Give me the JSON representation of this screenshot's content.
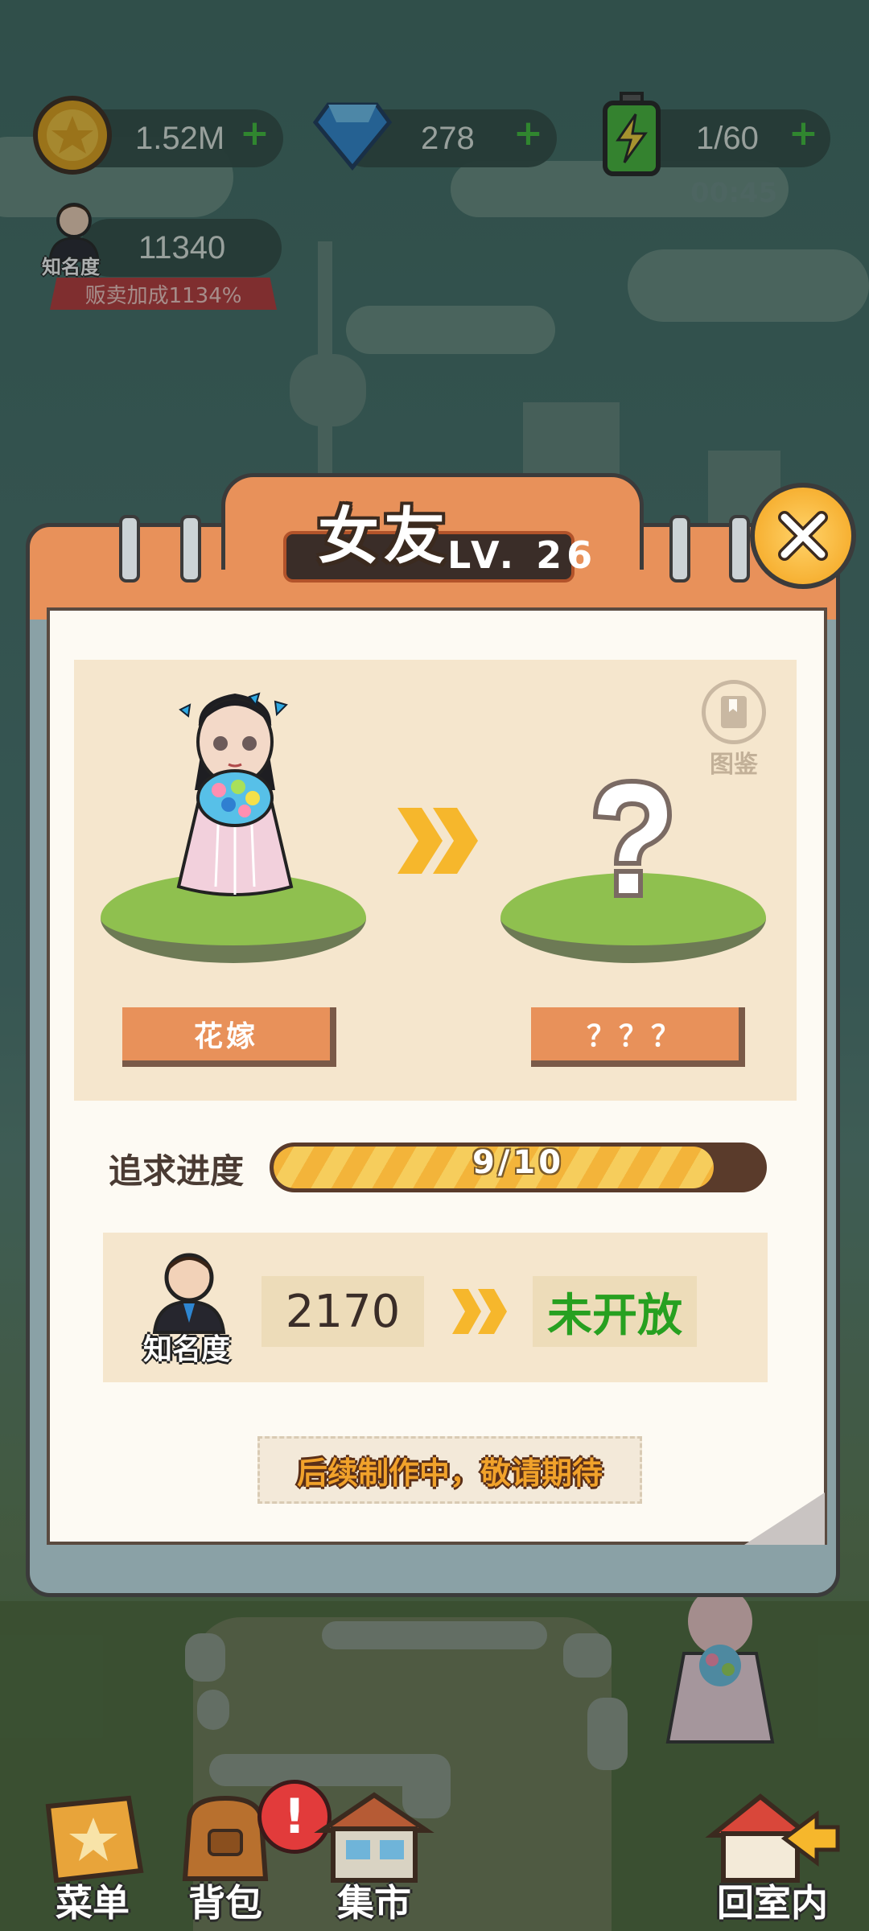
{
  "hud": {
    "coins": "1.52M",
    "gems": "278",
    "energy": "1/60",
    "energy_timer": "00:45",
    "fame": "11340",
    "fame_label": "知名度",
    "sell_bonus": "贩卖加成1134%"
  },
  "popup": {
    "title": "女友",
    "level": "LV. 26",
    "current_name": "花嫁",
    "next_name": "？？？",
    "codex_label": "图鉴",
    "progress_label": "追求进度",
    "progress_text": "9/10",
    "progress_value": 0.9,
    "req_label": "知名度",
    "req_value": "2170",
    "req_status": "未开放",
    "coming_soon": "后续制作中，敬请期待"
  },
  "nav": {
    "menu": "菜单",
    "bag": "背包",
    "bag_badge": "!",
    "market": "集市",
    "home": "回室内"
  },
  "colors": {
    "panel_orange": "#e8915a",
    "status_green": "#27a020",
    "progress_yellow": "#f3b43a"
  }
}
